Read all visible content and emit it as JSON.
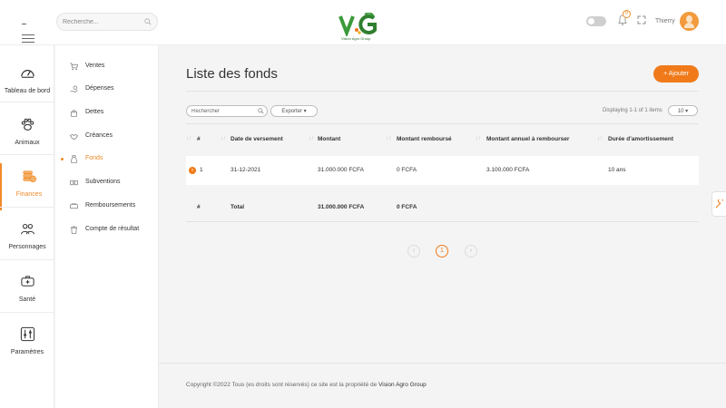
{
  "header": {
    "search_placeholder": "Recherche...",
    "logo_text": "VG",
    "logo_subtext": "Vision Agro Group",
    "notifications_count": "0",
    "username": "Thierry"
  },
  "rail": {
    "items": [
      {
        "label": "Tableau de bord",
        "icon": "dashboard-gauge-icon"
      },
      {
        "label": "Animaux",
        "icon": "paw-icon"
      },
      {
        "label": "Finances",
        "icon": "coins-icon",
        "active": true
      },
      {
        "label": "Personnages",
        "icon": "people-icon"
      },
      {
        "label": "Santé",
        "icon": "health-icon"
      },
      {
        "label": "Paramètres",
        "icon": "sliders-icon"
      }
    ]
  },
  "submenu": {
    "items": [
      {
        "label": "Ventes",
        "icon": "cart-icon"
      },
      {
        "label": "Dépenses",
        "icon": "hand-money-icon"
      },
      {
        "label": "Dettes",
        "icon": "bag-icon"
      },
      {
        "label": "Créances",
        "icon": "handshake-icon"
      },
      {
        "label": "Fonds",
        "icon": "money-bag-icon",
        "active": true
      },
      {
        "label": "Subventions",
        "icon": "banknote-icon"
      },
      {
        "label": "Remboursements",
        "icon": "refund-icon"
      },
      {
        "label": "Compte de résultat",
        "icon": "trash-doc-icon"
      }
    ]
  },
  "main": {
    "title": "Liste des fonds",
    "add_label": "+ Ajouter",
    "table_search_placeholder": "Rechercher",
    "export_label": "Exporter ▾",
    "displaying": "Displaying 1-1 of 1 items",
    "page_size": "10 ▾",
    "columns": [
      "#",
      "Date de versement",
      "Montant",
      "Montant remboursé",
      "Montant annuel à rembourser",
      "Durée d'amortissement"
    ],
    "rows": [
      {
        "num": "1",
        "date": "31-12-2021",
        "montant": "31.000.000 FCFA",
        "rembourse": "0 FCFA",
        "annuel": "3.100.000 FCFA",
        "duree": "10 ans"
      }
    ],
    "footer": {
      "num": "#",
      "label": "Total",
      "montant": "31.000.000 FCFA",
      "rembourse": "0 FCFA"
    },
    "pagination": {
      "prev": "‹",
      "current": "1",
      "next": "›"
    }
  },
  "footer": {
    "text": "Copyright ©2022 Tous (es droits sont réservés) ce site est la propriété de",
    "brand": "Vision Agro Group"
  },
  "colors": {
    "accent": "#f07a1a",
    "logo_green": "#2f8a2f"
  }
}
